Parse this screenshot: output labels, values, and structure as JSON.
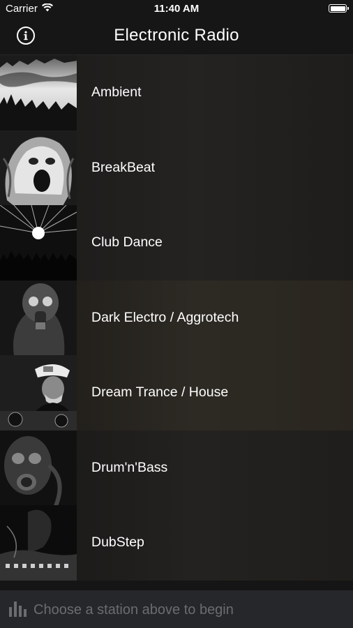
{
  "status_bar": {
    "carrier": "Carrier",
    "time": "11:40 AM",
    "icons": [
      "wifi-icon",
      "battery-icon"
    ]
  },
  "nav": {
    "title": "Electronic Radio",
    "left_icon": "info-icon"
  },
  "stations": [
    {
      "name": "Ambient",
      "thumbnail": "misty-forest-image"
    },
    {
      "name": "BreakBeat",
      "thumbnail": "screaming-face-image"
    },
    {
      "name": "Club Dance",
      "thumbnail": "club-lights-crowd-image"
    },
    {
      "name": "Dark Electro / Aggrotech",
      "thumbnail": "gas-mask-figure-image"
    },
    {
      "name": "Dream Trance / House",
      "thumbnail": "dj-captain-hat-image"
    },
    {
      "name": "Drum'n'Bass",
      "thumbnail": "gas-mask-closeup-image"
    },
    {
      "name": "DubStep",
      "thumbnail": "dj-mixer-image"
    }
  ],
  "player": {
    "message": "Choose a station above to begin",
    "icon": "equalizer-bars-icon"
  }
}
